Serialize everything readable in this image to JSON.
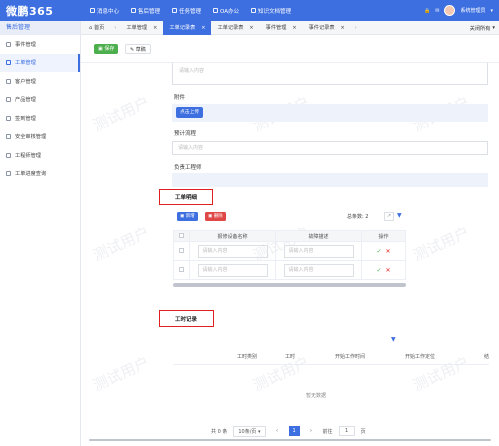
{
  "app": {
    "logo": "微鹏365",
    "top_nav": [
      {
        "label": "消息中心",
        "icon": "bell-icon"
      },
      {
        "label": "售后管理",
        "icon": "wrench-icon"
      },
      {
        "label": "任务管理",
        "icon": "task-icon"
      },
      {
        "label": "OA办公",
        "icon": "office-icon"
      },
      {
        "label": "知识文档管理",
        "icon": "document-icon"
      }
    ],
    "user_name": "系统管理员",
    "user_caret": "▾"
  },
  "sidebar": {
    "title": "售后管理",
    "items": [
      {
        "label": "事件管理",
        "active": false
      },
      {
        "label": "工单管理",
        "active": true
      },
      {
        "label": "客户管理",
        "active": false
      },
      {
        "label": "产品管理",
        "active": false
      },
      {
        "label": "签到管理",
        "active": false
      },
      {
        "label": "安全审核管理",
        "active": false
      },
      {
        "label": "工程师管理",
        "active": false
      },
      {
        "label": "工单进度查询",
        "active": false
      }
    ]
  },
  "tabs": {
    "prev": "‹",
    "next": "›",
    "items": [
      {
        "label": "首页",
        "closable": false,
        "active": false
      },
      {
        "label": "工单管理",
        "closable": true,
        "active": false
      },
      {
        "label": "工单记录表",
        "closable": true,
        "active": true
      },
      {
        "label": "工单记录表",
        "closable": true,
        "active": false
      },
      {
        "label": "事件管理",
        "closable": true,
        "active": false
      },
      {
        "label": "事件记录表",
        "closable": true,
        "active": false
      }
    ],
    "close_all": "关闭所有",
    "close_symbol": "×"
  },
  "toolbar": {
    "save_label": "保存",
    "draft_label": "草稿"
  },
  "form": {
    "textarea_placeholder": "请输入内容",
    "attachment_label": "附件",
    "upload_label": "点击上传",
    "planned_process_label": "预计流程",
    "planned_process_placeholder": "请输入内容",
    "engineer_label": "负责工程师"
  },
  "detail": {
    "title": "工单明细",
    "add_label": "新增",
    "delete_label": "删除",
    "total_label": "总条数:",
    "total_count": "2",
    "columns": [
      "报修设备名称",
      "故障描述",
      "操作"
    ],
    "rows": [
      {
        "device_placeholder": "请输入内容",
        "fault_placeholder": "请输入内容",
        "ok": "✓",
        "cancel": "✕"
      },
      {
        "device_placeholder": "请输入内容",
        "fault_placeholder": "请输入内容",
        "ok": "✓",
        "cancel": "✕"
      }
    ]
  },
  "records": {
    "title": "工时记录",
    "columns": [
      "工时类别",
      "工时",
      "开始工作时间",
      "开始工作定位",
      "结"
    ],
    "empty_text": "暂无数据"
  },
  "pagination": {
    "total_text": "共 0 条",
    "page_size": "10条/页",
    "prev": "‹",
    "current_page": "1",
    "next": "›",
    "goto_label": "前往",
    "goto_value": "1",
    "page_unit": "页"
  },
  "watermark": "测试用户",
  "colors": {
    "primary": "#3d6fe0",
    "success": "#4cae4c",
    "danger": "#e02020",
    "highlight_box": "#e02020"
  }
}
